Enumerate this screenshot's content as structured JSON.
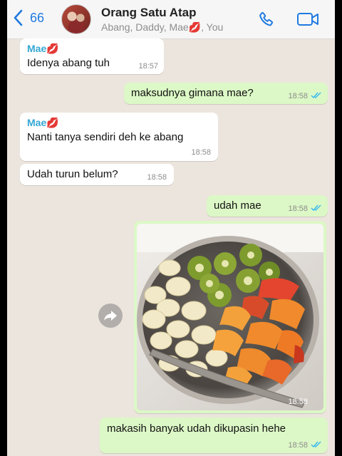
{
  "header": {
    "back_count": "66",
    "title": "Orang Satu Atap",
    "subtitle": "Abang, Daddy, Mae💋, You"
  },
  "messages": [
    {
      "sender": "Mae💋",
      "text": "Idenya abang tuh",
      "time": "18:57",
      "direction": "in"
    },
    {
      "text": "maksudnya gimana mae?",
      "time": "18:58",
      "direction": "out",
      "status": "read"
    },
    {
      "sender": "Mae💋",
      "text": "Nanti tanya sendiri deh ke abang",
      "time": "18:58",
      "direction": "in"
    },
    {
      "text": "Udah turun belum?",
      "time": "18:58",
      "direction": "in"
    },
    {
      "text": "udah mae",
      "time": "18:58",
      "direction": "out",
      "status": "read"
    },
    {
      "type": "photo",
      "time": "18:58",
      "direction": "out"
    },
    {
      "text": "makasih banyak udah dikupasin hehe",
      "time": "18:58",
      "direction": "out",
      "status": "read"
    }
  ],
  "colors": {
    "accent": "#1f7ae0",
    "incoming_bubble": "#ffffff",
    "outgoing_bubble": "#dcf8c6",
    "chat_background": "#ece5dd",
    "sender_name": "#35a7d3",
    "read_ticks": "#34b7f1"
  },
  "icons": [
    "chevron-left-icon",
    "phone-icon",
    "video-camera-icon",
    "forward-icon",
    "double-check-icon"
  ]
}
